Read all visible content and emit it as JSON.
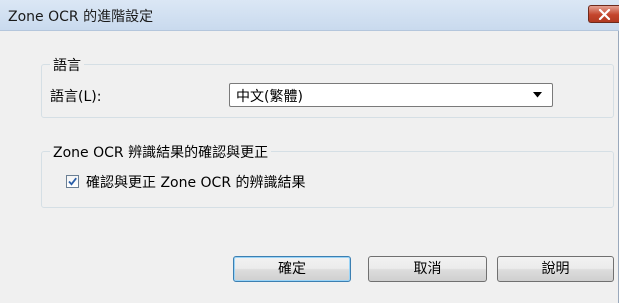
{
  "window": {
    "title": "Zone OCR 的進階設定"
  },
  "language_group": {
    "title": "語言",
    "label": "語言(L):",
    "selected_value": "中文(繁體)"
  },
  "zone_group": {
    "title": "Zone OCR 辨識結果的確認與更正",
    "checkbox_label": "確認與更正 Zone OCR 的辨識結果",
    "checked": true
  },
  "buttons": {
    "ok": "確定",
    "cancel": "取消",
    "help": "說明"
  },
  "colors": {
    "title_bar": "#c9daee",
    "close_button": "#c4452c",
    "default_button_border": "#3c7fb1"
  }
}
